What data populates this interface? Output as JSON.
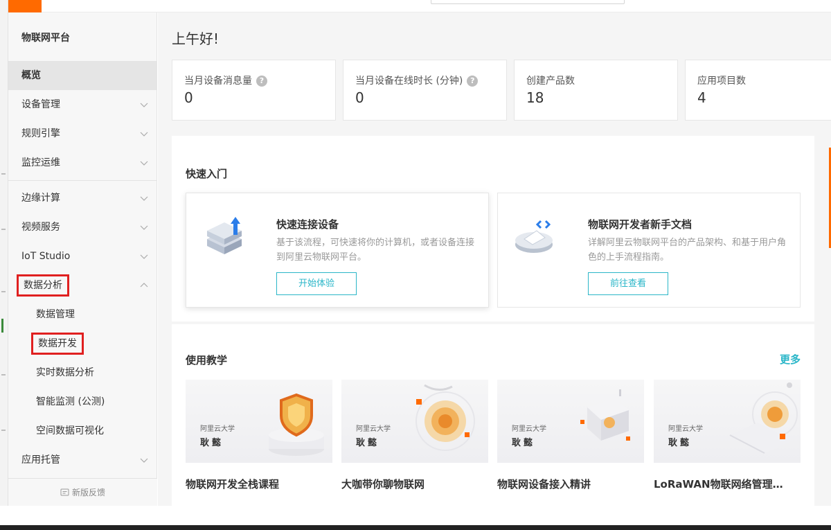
{
  "header": {
    "logo_text": ""
  },
  "sidebar": {
    "title": "物联网平台",
    "items": [
      {
        "label": "概览"
      },
      {
        "label": "设备管理"
      },
      {
        "label": "规则引擎"
      },
      {
        "label": "监控运维"
      },
      {
        "label": "边缘计算"
      },
      {
        "label": "视频服务"
      },
      {
        "label": "IoT Studio"
      },
      {
        "label": "数据分析"
      },
      {
        "label": "数据管理"
      },
      {
        "label": "数据开发"
      },
      {
        "label": "实时数据分析"
      },
      {
        "label": "智能监测 (公测)"
      },
      {
        "label": "空间数据可视化"
      },
      {
        "label": "应用托管"
      }
    ],
    "feedback": "新版反馈"
  },
  "main": {
    "greeting": "上午好!",
    "stats": [
      {
        "label": "当月设备消息量",
        "value": "0",
        "help": "?"
      },
      {
        "label": "当月设备在线时长 (分钟)",
        "value": "0",
        "help": "?"
      },
      {
        "label": "创建产品数",
        "value": "18"
      },
      {
        "label": "应用项目数",
        "value": "4"
      }
    ],
    "quick_start": {
      "title": "快速入门",
      "cards": [
        {
          "title": "快速连接设备",
          "desc": "基于该流程，可快速将你的计算机，或者设备连接到阿里云物联网平台。",
          "button": "开始体验"
        },
        {
          "title": "物联网开发者新手文档",
          "desc": "详解阿里云物联网平台的产品架构、和基于用户角色的上手流程指南。",
          "button": "前往查看"
        }
      ]
    },
    "tutorials": {
      "title": "使用教学",
      "more": "更多",
      "items": [
        {
          "brand": "阿里云大学",
          "author": "耿懿",
          "title": "物联网开发全栈课程"
        },
        {
          "brand": "阿里云大学",
          "author": "耿懿",
          "title": "大咖带你聊物联网"
        },
        {
          "brand": "阿里云大学",
          "author": "耿懿",
          "title": "物联网设备接入精讲"
        },
        {
          "brand": "阿里云大学",
          "author": "耿懿",
          "title": "LoRaWAN物联网络管理…"
        }
      ]
    }
  },
  "colors": {
    "brand_orange": "#ff6a00",
    "accent_teal": "#2ab6c8",
    "highlight_red": "#e02020"
  }
}
